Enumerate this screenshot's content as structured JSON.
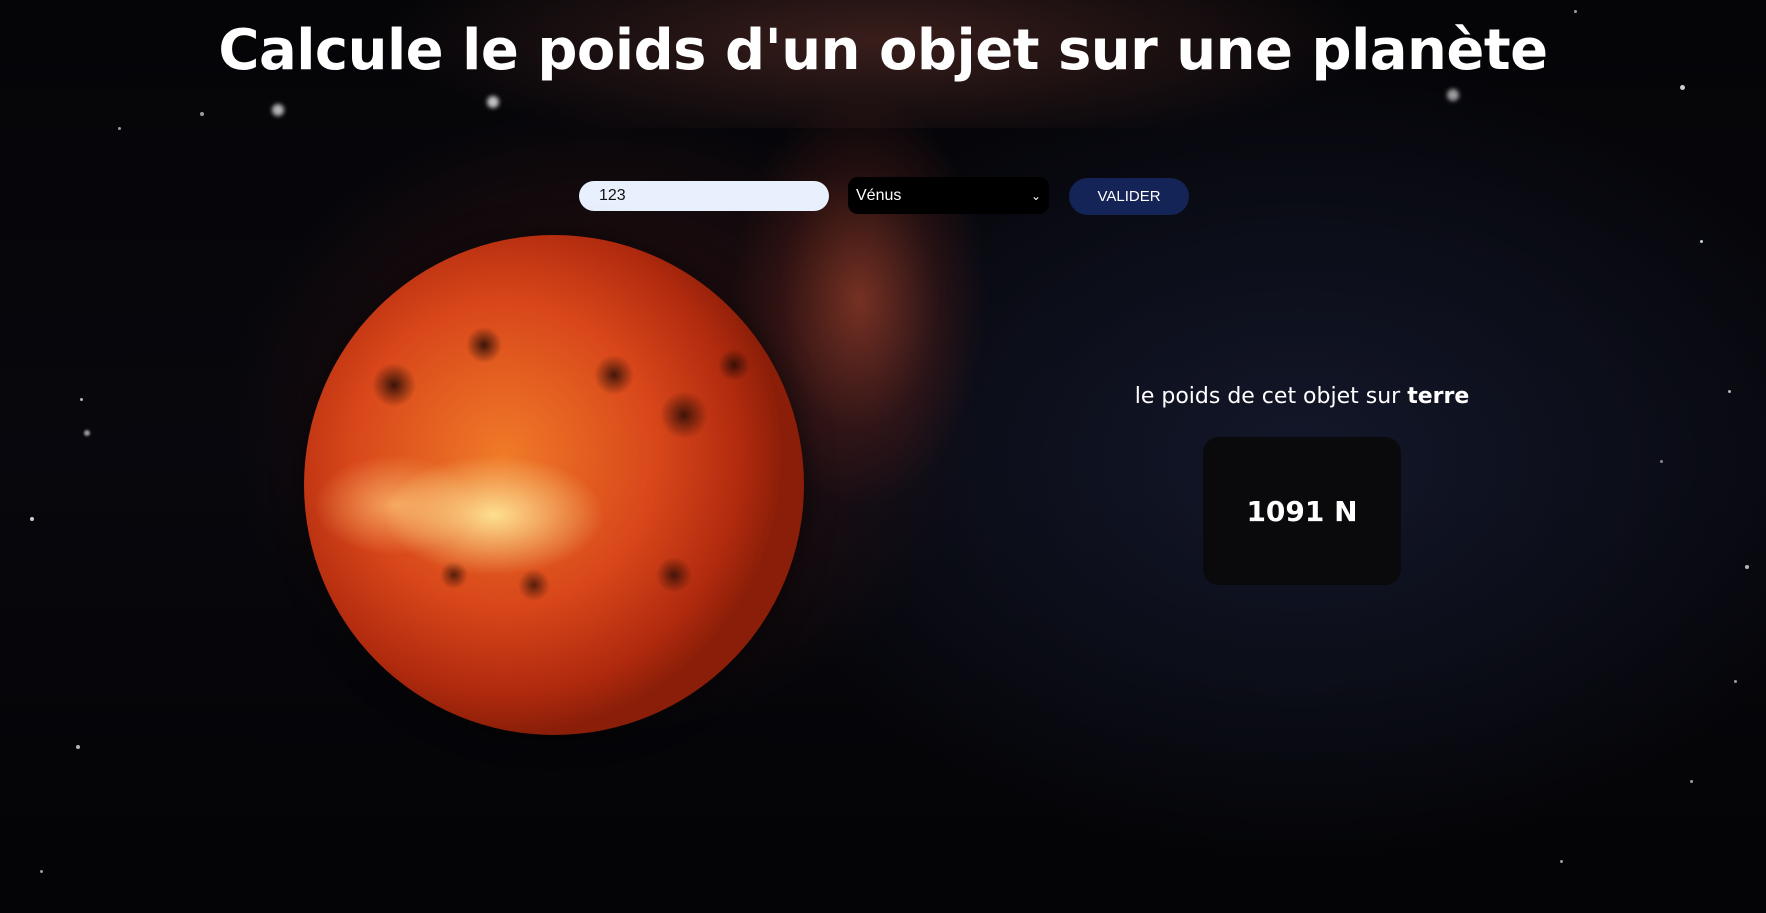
{
  "header": {
    "title": "Calcule le poids d'un objet sur une planète"
  },
  "form": {
    "weight_value": "123",
    "planet_selected": "Vénus",
    "submit_label": "VALIDER"
  },
  "result": {
    "label_prefix": "le poids de cet objet sur ",
    "label_planet": "terre",
    "value": "1091 N"
  },
  "colors": {
    "button_bg": "#152456",
    "input_bg": "#e8f0fe",
    "page_bg": "#050508"
  },
  "icons": {
    "select_arrow": "chevron-down-icon"
  }
}
